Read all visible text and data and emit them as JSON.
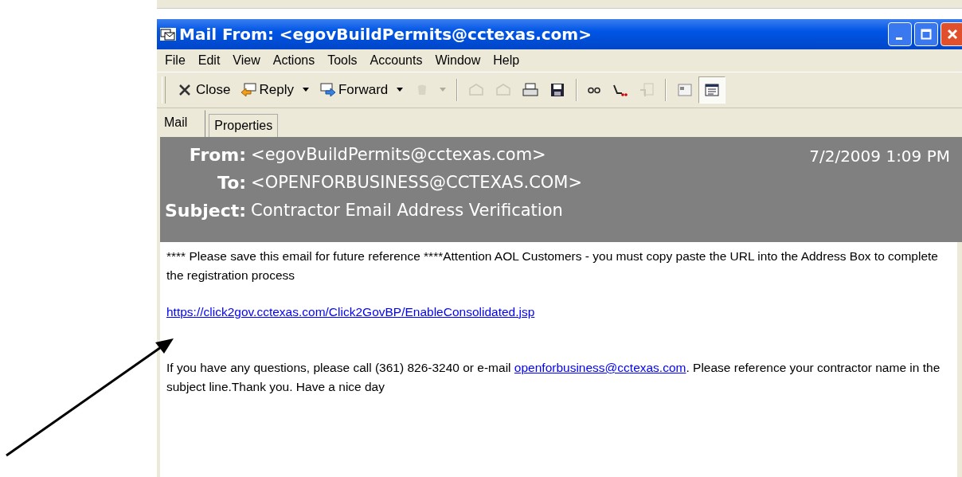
{
  "window": {
    "title": "Mail From: <egovBuildPermits@cctexas.com>"
  },
  "menu": [
    "File",
    "Edit",
    "View",
    "Actions",
    "Tools",
    "Accounts",
    "Window",
    "Help"
  ],
  "toolbar": [
    {
      "kind": "button",
      "label": "Close",
      "disabled": false,
      "pressed": false
    },
    {
      "kind": "button",
      "label": "Reply",
      "dropdown": true,
      "disabled": false,
      "pressed": false
    },
    {
      "kind": "button",
      "label": "Forward",
      "dropdown": true,
      "disabled": false,
      "pressed": false
    },
    {
      "kind": "button",
      "dropdown": true,
      "disabled": true,
      "pressed": false
    },
    {
      "kind": "separator"
    },
    {
      "kind": "button",
      "disabled": true,
      "pressed": false
    },
    {
      "kind": "button",
      "disabled": true,
      "pressed": false
    },
    {
      "kind": "button",
      "disabled": false,
      "pressed": false
    },
    {
      "kind": "button",
      "disabled": false,
      "pressed": false
    },
    {
      "kind": "separator"
    },
    {
      "kind": "button",
      "disabled": false,
      "pressed": false
    },
    {
      "kind": "button",
      "disabled": false,
      "pressed": false
    },
    {
      "kind": "button",
      "disabled": true,
      "pressed": false
    },
    {
      "kind": "separator"
    },
    {
      "kind": "button",
      "disabled": false,
      "pressed": false
    },
    {
      "kind": "button",
      "disabled": false,
      "pressed": true
    }
  ],
  "tabs": [
    {
      "label": "Mail",
      "selected": true
    },
    {
      "label": "Properties",
      "selected": false
    }
  ],
  "header": {
    "fields": [
      {
        "label": "From:",
        "value": "<egovBuildPermits@cctexas.com>"
      },
      {
        "label": "To:",
        "value": "<OPENFORBUSINESS@CCTEXAS.COM>"
      },
      {
        "label": "Subject:",
        "value": "Contractor Email Address Verification"
      }
    ],
    "date": "7/2/2009 1:09 PM"
  },
  "body": [
    {
      "kind": "text",
      "text": "**** Please save this email for future reference ****Attention AOL Customers - you must copy paste the URL into the Address Box to complete the registration process"
    },
    {
      "kind": "link",
      "text": "https://click2gov.cctexas.com/Click2GovBP/EnableConsolidated.jsp"
    },
    {
      "kind": "mixed",
      "before": "If you have any questions, please call (361) 826-3240 or e-mail ",
      "link": "openforbusiness@cctexas.com",
      "after": ".  Please reference your contractor name in the subject line.Thank you.  Have a nice day"
    }
  ]
}
